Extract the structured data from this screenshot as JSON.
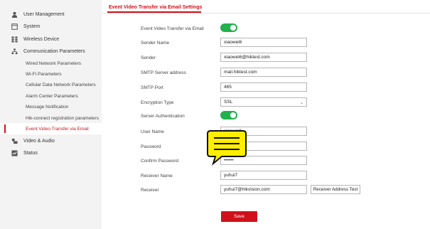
{
  "sidebar": {
    "items": [
      {
        "label": "User Management",
        "icon": "user-icon"
      },
      {
        "label": "System",
        "icon": "system-icon"
      },
      {
        "label": "Wireless Device",
        "icon": "device-grid-icon"
      },
      {
        "label": "Communication Parameters",
        "icon": "network-icon"
      }
    ],
    "sub_items": [
      {
        "label": "Wired Network Parameters"
      },
      {
        "label": "Wi-Fi Parameters"
      },
      {
        "label": "Cellular Data Network Parameters"
      },
      {
        "label": "Alarm Center Parameters"
      },
      {
        "label": "Message Notification"
      },
      {
        "label": "Hik-connect registration parameters"
      },
      {
        "label": "Event Video Transfer via Email"
      }
    ],
    "bottom_items": [
      {
        "label": "Video & Audio",
        "icon": "video-audio-icon"
      },
      {
        "label": "Status",
        "icon": "status-icon"
      }
    ]
  },
  "header": {
    "title": "Event Video Transfer via Email Settings"
  },
  "form": {
    "enable_label": "Event Video Transfer via Email",
    "sender_name_label": "Sender Name",
    "sender_name_value": "xiaowei6",
    "sender_label": "Sender",
    "sender_value": "xiaowei6@hiktest.com",
    "smtp_address_label": "SMTP Server address",
    "smtp_address_value": "mail.hiktest.com",
    "smtp_port_label": "SMTP Port",
    "smtp_port_value": "465",
    "encryption_label": "Encryption Type",
    "encryption_value": "SSL",
    "auth_label": "Server Authentication",
    "username_label": "User Name",
    "username_value": "xiaowei6",
    "password_label": "Password",
    "password_value": "",
    "confirm_label": "Confirm Password",
    "confirm_value": "••••••",
    "receiver_name_label": "Receiver Name",
    "receiver_name_value": "yuhui7",
    "receiver_label": "Receiver",
    "receiver_value": "yuhui7@hikvision.com",
    "test_button": "Receiver Address Test",
    "save_button": "Save"
  },
  "colors": {
    "accent": "#d0111b",
    "toggle_on": "#22b14c",
    "note_yellow": "#ffee00"
  }
}
